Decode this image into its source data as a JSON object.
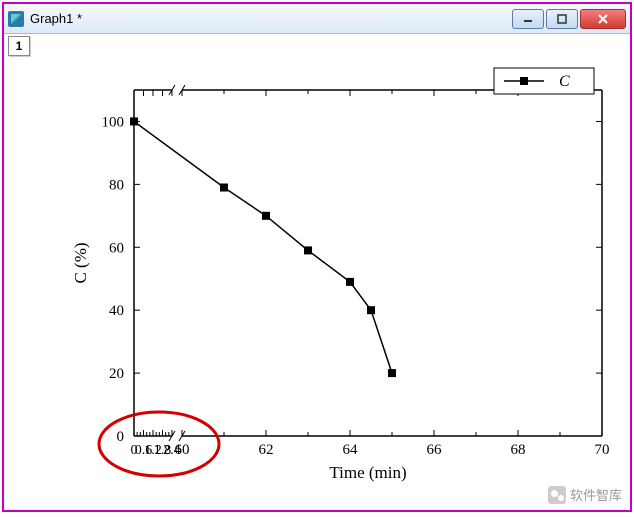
{
  "window": {
    "title": "Graph1 *",
    "tab_label": "1"
  },
  "legend": {
    "series_label": "C"
  },
  "chart_data": {
    "type": "line",
    "xlabel": "Time (min)",
    "ylabel": "C (%)",
    "x": [
      0,
      61,
      62,
      63,
      64,
      65
    ],
    "values": [
      100,
      79,
      70,
      59,
      49,
      40,
      20
    ],
    "x_ticks_seg1": [
      0,
      0.6,
      1.2,
      1.8,
      2.4
    ],
    "x_ticks_seg2": [
      60,
      62,
      64,
      66,
      68,
      70
    ],
    "y_ticks": [
      0,
      20,
      40,
      60,
      80,
      100
    ],
    "ylim": [
      0,
      110
    ],
    "axis_break": true
  },
  "watermark": "软件智库"
}
